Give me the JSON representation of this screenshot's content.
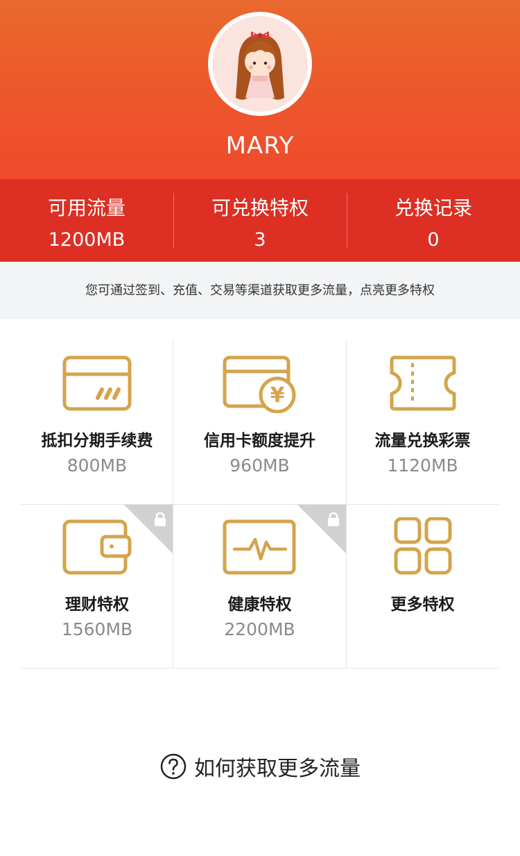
{
  "profile": {
    "username": "MARY"
  },
  "stats": [
    {
      "label": "可用流量",
      "value": "1200MB"
    },
    {
      "label": "可兑换特权",
      "value": "3"
    },
    {
      "label": "兑换记录",
      "value": "0"
    }
  ],
  "notice": "您可通过签到、充值、交易等渠道获取更多流量，点亮更多特权",
  "privileges": [
    {
      "title": "抵扣分期手续费",
      "value": "800MB",
      "icon": "card-icon",
      "locked": false
    },
    {
      "title": "信用卡额度提升",
      "value": "960MB",
      "icon": "card-yuan-icon",
      "locked": false
    },
    {
      "title": "流量兑换彩票",
      "value": "1120MB",
      "icon": "ticket-icon",
      "locked": false
    },
    {
      "title": "理财特权",
      "value": "1560MB",
      "icon": "wallet-icon",
      "locked": true
    },
    {
      "title": "健康特权",
      "value": "2200MB",
      "icon": "heartbeat-icon",
      "locked": true
    },
    {
      "title": "更多特权",
      "value": "",
      "icon": "grid-icon",
      "locked": false
    }
  ],
  "help": {
    "label": "如何获取更多流量"
  },
  "colors": {
    "header_top": "#e9692d",
    "header_bottom": "#ef4a2c",
    "stats_bg": "#dd2f23",
    "icon_gold": "#d4a44c"
  }
}
